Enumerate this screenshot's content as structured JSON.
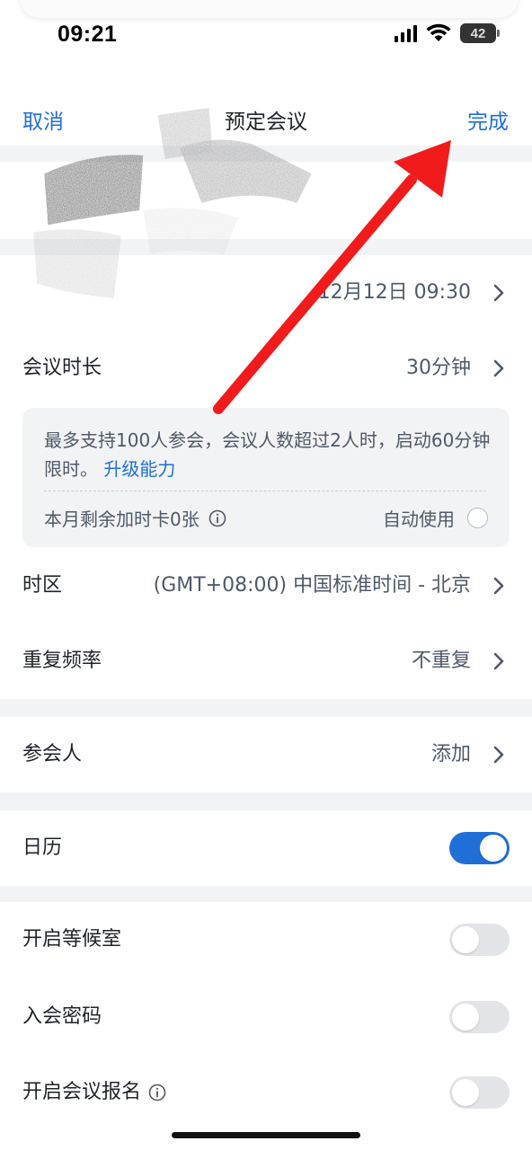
{
  "status_bar": {
    "time": "09:21",
    "battery_level": "42",
    "icons": [
      "signal-icon",
      "wifi-icon",
      "battery-icon"
    ]
  },
  "nav": {
    "cancel_label": "取消",
    "title": "预定会议",
    "done_label": "完成"
  },
  "rows": {
    "start_time_value": "12月12日 09:30",
    "duration_label": "会议时长",
    "duration_value": "30分钟",
    "timezone_label": "时区",
    "timezone_value": "(GMT+08:00) 中国标准时间 - 北京",
    "repeat_label": "重复频率",
    "repeat_value": "不重复",
    "participants_label": "参会人",
    "participants_value": "添加",
    "calendar_label": "日历",
    "waiting_room_label": "开启等候室",
    "password_label": "入会密码",
    "registration_label": "开启会议报名"
  },
  "notice": {
    "text": "最多支持100人参会，会议人数超过2人时，启动60分钟限时。",
    "link": "升级能力",
    "remaining_cards": "本月剩余加时卡0张",
    "auto_use": "自动使用"
  },
  "toggles": {
    "calendar": true,
    "waiting_room": false,
    "password": false,
    "registration": false
  },
  "colors": {
    "accent": "#1f6fd6",
    "annotation_arrow": "#f21b1b",
    "background": "#f2f3f5"
  }
}
